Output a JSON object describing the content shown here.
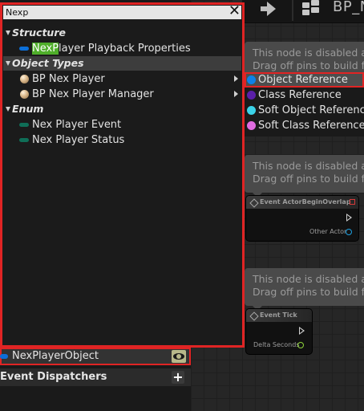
{
  "graph": {
    "tab_title": "BP_N",
    "comments": [
      {
        "line1": "This node is disabled a",
        "line2": "Drag off pins to build fu"
      },
      {
        "line1": "This node is disabled a",
        "line2": "Drag off pins to build fu"
      },
      {
        "line1": "This node is disabled a",
        "line2": "Drag off pins to build fu"
      }
    ],
    "nodes": [
      {
        "title": "Event ActorBeginOverlap",
        "output_pin": "Other Actor"
      },
      {
        "title": "Event Tick",
        "output_pin": "Delta Seconds"
      }
    ]
  },
  "popup": {
    "search_value": "Nexp",
    "close_glyph": "✕",
    "categories": {
      "structure": "Structure",
      "object_types": "Object Types",
      "enum": "Enum"
    },
    "structure_item": {
      "highlight": "NexP",
      "rest": "layer Playback Properties"
    },
    "object_items": [
      "BP Nex Player",
      "BP Nex Player Manager"
    ],
    "enum_items": [
      "Nex Player Event",
      "Nex Player Status"
    ]
  },
  "submenu": {
    "items": [
      "Object Reference",
      "Class Reference",
      "Soft Object Reference",
      "Soft Class Reference"
    ],
    "colors": [
      "#0c82e8",
      "#5a1fa8",
      "#3bd3e8",
      "#e06be0"
    ]
  },
  "my_blueprint": {
    "variable_name": "NexPlayerObject",
    "event_dispatchers": "Event Dispatchers",
    "add_glyph": "+"
  }
}
